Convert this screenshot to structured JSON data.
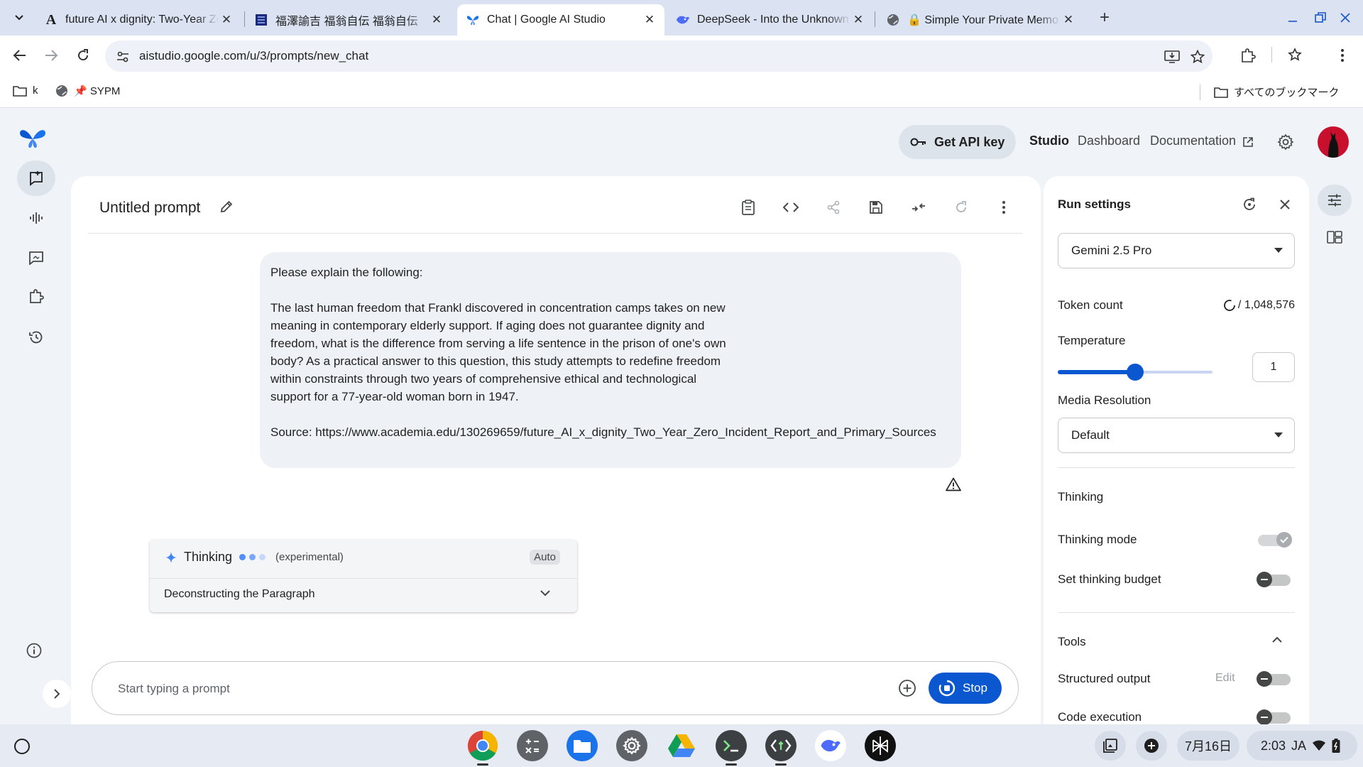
{
  "browser": {
    "tabs": [
      {
        "title": "future AI x dignity: Two-Year Zero",
        "favicon": "academia-icon"
      },
      {
        "title": "福澤諭吉 福翁自伝 福翁自伝",
        "favicon": "blue-book-icon"
      },
      {
        "title": "Chat | Google AI Studio",
        "favicon": "ai-studio-icon",
        "active": true
      },
      {
        "title": "DeepSeek - Into the Unknown",
        "favicon": "deepseek-icon"
      },
      {
        "title": "🔒 Simple Your Private Memo",
        "favicon": "globe-icon"
      }
    ],
    "url": "aistudio.google.com/u/3/prompts/new_chat",
    "bookmarks": [
      {
        "label": "k",
        "icon": "folder-icon"
      },
      {
        "label": "📌 SYPM",
        "icon": "globe-icon"
      }
    ],
    "all_bookmarks": "すべてのブックマーク"
  },
  "header": {
    "api_key": "Get API key",
    "nav": [
      "Studio",
      "Dashboard",
      "Documentation"
    ]
  },
  "prompt": {
    "title": "Untitled prompt",
    "message": {
      "line1": "Please explain the following:",
      "body": "The last human freedom that Frankl discovered in concentration camps takes on new meaning in contemporary elderly support. If aging does not guarantee dignity and freedom, what is the difference from serving a life sentence in the prison of one's own body? As a practical answer to this question, this study attempts to redefine freedom within constraints through two years of comprehensive ethical and technological support for a 77-year-old woman born in 1947.",
      "source": "Source: https://www.academia.edu/130269659/future_AI_x_dignity_Two_Year_Zero_Incident_Report_and_Primary_Sources"
    },
    "thinking": {
      "label": "Thinking",
      "tag": "(experimental)",
      "badge": "Auto",
      "step": "Deconstructing the Paragraph"
    },
    "input_placeholder": "Start typing a prompt",
    "stop_label": "Stop"
  },
  "run_settings": {
    "title": "Run settings",
    "model": "Gemini 2.5 Pro",
    "token_count_label": "Token count",
    "token_count_value": "/ 1,048,576",
    "temperature_label": "Temperature",
    "temperature_value": "1",
    "temperature_fraction": 0.5,
    "media_resolution_label": "Media Resolution",
    "media_resolution_value": "Default",
    "thinking_section": "Thinking",
    "thinking_mode_label": "Thinking mode",
    "thinking_budget_label": "Set thinking budget",
    "tools_section": "Tools",
    "structured_output_label": "Structured output",
    "edit_label": "Edit",
    "code_execution_label": "Code execution"
  },
  "shelf": {
    "date": "7月16日",
    "time": "2:03",
    "ime": "JA"
  },
  "colors": {
    "accent": "#0b57d0",
    "tabstrip": "#dbe3f3",
    "background": "#f0f4f9"
  }
}
